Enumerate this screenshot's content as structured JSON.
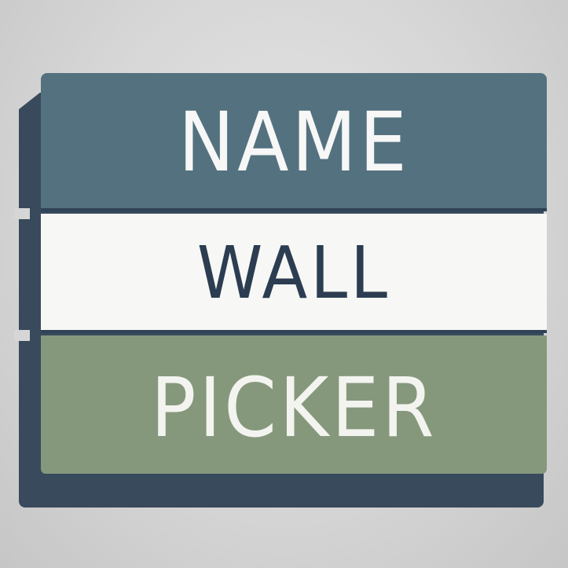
{
  "logo": {
    "words": {
      "name": "NAME",
      "wall": "WALL",
      "picker": "PICKER"
    },
    "colors": {
      "background": "#d6d6d6",
      "top_band": "#54717f",
      "middle_band": "#f7f7f5",
      "bottom_band": "#86987c",
      "shadow": "#384a5c",
      "dark_text": "#2c3d52",
      "light_text": "#f6f7f6"
    }
  }
}
